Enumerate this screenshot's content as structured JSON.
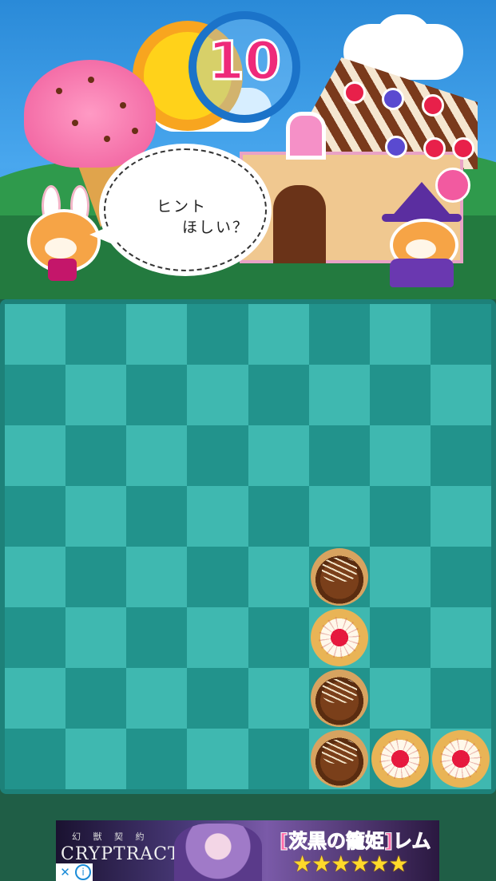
{
  "timer": {
    "value": "10"
  },
  "hint_bubble": {
    "line1": "ヒント",
    "line2": "ほしい？"
  },
  "board": {
    "rows": 8,
    "cols": 8,
    "pieces": [
      {
        "row": 4,
        "col": 5,
        "type": "chocolate-cookie"
      },
      {
        "row": 5,
        "col": 5,
        "type": "cherry-cookie"
      },
      {
        "row": 6,
        "col": 5,
        "type": "chocolate-cookie"
      },
      {
        "row": 7,
        "col": 5,
        "type": "chocolate-cookie"
      },
      {
        "row": 7,
        "col": 6,
        "type": "cherry-cookie"
      },
      {
        "row": 7,
        "col": 7,
        "type": "cherry-cookie"
      }
    ]
  },
  "ad": {
    "logo_top": "幻 獣 契 約",
    "logo": "CRYPTRACT",
    "title": "[茨黒の籠姫]レム",
    "stars": "★★★★★★",
    "close_label": "✕",
    "info_label": "i"
  },
  "colors": {
    "board_light": "#3fb8b0",
    "board_dark": "#22938c",
    "timer_text": "#ee2a7a"
  }
}
